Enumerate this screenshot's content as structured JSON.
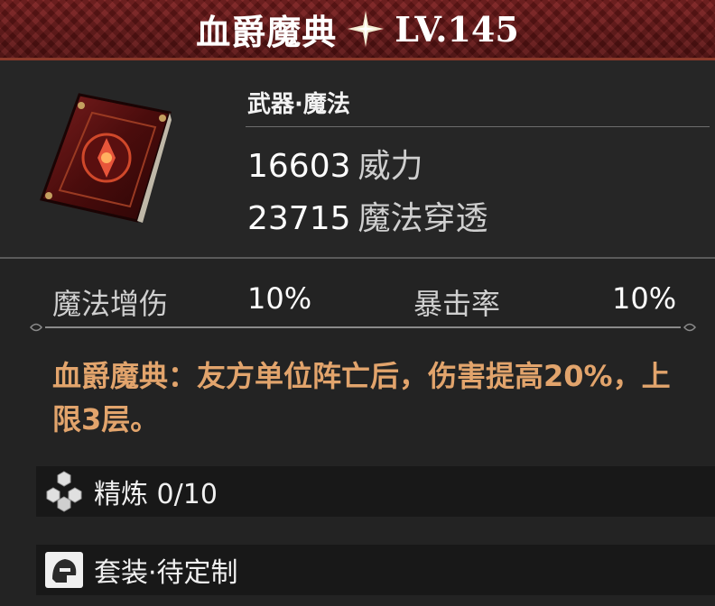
{
  "header": {
    "title": "血爵魔典",
    "level": "LV.145"
  },
  "item": {
    "type": "武器·魔法",
    "stats": [
      {
        "value": "16603",
        "name": "威力"
      },
      {
        "value": "23715",
        "name": "魔法穿透"
      }
    ]
  },
  "substats": [
    {
      "name": "魔法增伤",
      "value": "10%"
    },
    {
      "name": "暴击率",
      "value": "10%"
    }
  ],
  "description": "血爵魔典：友方单位阵亡后，伤害提高20%，上限3层。",
  "refine": {
    "label": "精炼 0/10"
  },
  "set": {
    "label": "套装·待定制"
  },
  "colors": {
    "header_bg": "#6b1a1a",
    "description_text": "#e2a46c",
    "panel_bg": "#232323"
  }
}
